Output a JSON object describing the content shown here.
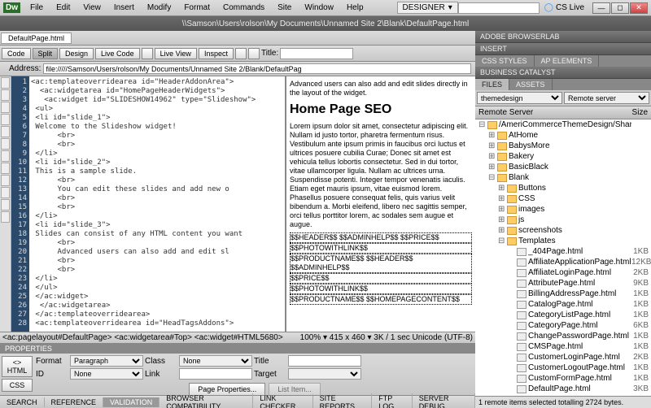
{
  "menu": {
    "items": [
      "File",
      "Edit",
      "View",
      "Insert",
      "Modify",
      "Format",
      "Commands",
      "Site",
      "Window",
      "Help"
    ],
    "layout": "DESIGNER",
    "cslive": "CS Live"
  },
  "appicon": "Dw",
  "pathbar": {
    "center": "\\\\Samson\\Users\\rolson\\My Documents\\Unnamed Site 2\\Blank\\DefaultPage.html"
  },
  "doctabs": [
    "DefaultPage.html"
  ],
  "viewmodes": {
    "code": "Code",
    "split": "Split",
    "design": "Design",
    "livecode": "Live Code",
    "liveview": "Live View",
    "inspect": "Inspect",
    "titlelabel": "Title:",
    "titlevalue": ""
  },
  "address": {
    "label": "Address:",
    "value": "file://///Samson/Users/rolson/My Documents/Unnamed Site 2/Blank/DefaultPag"
  },
  "code_lines": [
    "<ac:templateoverridearea id=\"HeaderAddonArea\">",
    "  <ac:widgetarea id=\"HomePageHeaderWidgets\">",
    "   <ac:widget id=\"SLIDESHOW14962\" type=\"Slideshow\">",
    " <ul>",
    " <li id=\"slide_1\">",
    " Welcome to the Slideshow widget!",
    "      <br>",
    "      <br>",
    " </li>",
    " <li id=\"slide_2\">",
    " This is a sample slide.",
    "      <br>",
    "      You can edit these slides and add new o",
    "      <br>",
    "      <br>",
    " </li>",
    " <li id=\"slide_3\">",
    " Slides can consist of any HTML content you want",
    "      <br>",
    "      Advanced users can also add and edit sl",
    "      <br>",
    "      <br>",
    " </li>",
    " </ul>",
    " </ac:widget>",
    "  </ac:widgetarea>",
    " </ac:templateoverridearea>",
    " <ac:templateoverridearea id=\"HeadTagsAddons\">"
  ],
  "preview": {
    "para1": "Advanced users can also add and edit slides directly in the layout of the widget.",
    "heading": "Home Page SEO",
    "para2": "Lorem ipsum dolor sit amet, consectetur adipiscing elit. Nullam id justo tortor, pharetra fermentum risus. Vestibulum ante ipsum primis in faucibus orci luctus et ultrices posuere cubilia Curae; Donec sit amet est vehicula tellus lobortis consectetur. Sed in dui tortor, vitae ullamcorper ligula. Nullam ac ultrices urna. Suspendisse potenti. Integer tempor venenatis iaculis. Etiam eget mauris ipsum, vitae euismod lorem. Phasellus posuere consequat felis, quis varius velit bibendum a. Morbi eleifend, libero nec sagittis semper, orci tellus porttitor lorem, ac sodales sem augue et augue.",
    "placeholders": [
      "$$HEADER$$ $$ADMINHELP$$ $$PRICE$$",
      "$$PHOTOWITHLINK$$",
      "$$PRODUCTNAME$$ $$HEADER$$ $$ADMINHELP$$",
      "$$PRICE$$",
      "$$PHOTOWITHLINK$$",
      "$$PRODUCTNAME$$ $$HOMEPAGECONTENT$$"
    ]
  },
  "breadcrumb": {
    "path": "<ac:pagelayout#DefaultPage> <ac:widgetarea#Top> <ac:widget#HTML5680>",
    "meta": "100% ▾ 415 x 460 ▾ 3K / 1 sec Unicode (UTF-8)"
  },
  "properties": {
    "title": "PROPERTIES",
    "tabs": [
      "<> HTML",
      "CSS"
    ],
    "format_label": "Format",
    "format_value": "Paragraph",
    "class_label": "Class",
    "class_value": "None",
    "id_label": "ID",
    "id_value": "None",
    "link_label": "Link",
    "link_value": "",
    "titlef_label": "Title",
    "titlef_value": "",
    "target_label": "Target",
    "target_value": "",
    "pageprops": "Page Properties...",
    "listitem": "List Item..."
  },
  "bottomtabs": [
    "SEARCH",
    "REFERENCE",
    "VALIDATION",
    "BROWSER COMPATIBILITY",
    "LINK CHECKER",
    "SITE REPORTS",
    "FTP LOG",
    "SERVER DEBUG"
  ],
  "bottomtabs_active": 2,
  "rightpanels": {
    "browserlab": "ADOBE BROWSERLAB",
    "insert": "INSERT",
    "css": "CSS STYLES",
    "ap": "AP ELEMENTS",
    "business": "BUSINESS CATALYST",
    "files": "FILES",
    "assets": "ASSETS",
    "site": "themedesign",
    "conn": "Remote server",
    "treehead": {
      "server": "Remote Server",
      "size": "Size"
    },
    "rootpath": "/AmeriCommerceThemeDesign/Shared/Themes/",
    "folders_closed": [
      "AtHome",
      "BabysMore",
      "Bakery",
      "BasicBlack"
    ],
    "blank": "Blank",
    "blank_folders": [
      "Buttons",
      "CSS",
      "images",
      "js",
      "screenshots"
    ],
    "templates": "Templates",
    "template_files": [
      {
        "n": "_404Page.html",
        "s": "1KB"
      },
      {
        "n": "AffiliateApplicationPage.html",
        "s": "12KB"
      },
      {
        "n": "AffiliateLoginPage.html",
        "s": "2KB"
      },
      {
        "n": "AttributePage.html",
        "s": "9KB"
      },
      {
        "n": "BillingAddressPage.html",
        "s": "1KB"
      },
      {
        "n": "CatalogPage.html",
        "s": "1KB"
      },
      {
        "n": "CategoryListPage.html",
        "s": "1KB"
      },
      {
        "n": "CategoryPage.html",
        "s": "6KB"
      },
      {
        "n": "ChangePasswordPage.html",
        "s": "1KB"
      },
      {
        "n": "CMSPage.html",
        "s": "1KB"
      },
      {
        "n": "CustomerLoginPage.html",
        "s": "2KB"
      },
      {
        "n": "CustomerLogoutPage.html",
        "s": "1KB"
      },
      {
        "n": "CustomFormPage.html",
        "s": "1KB"
      },
      {
        "n": "DefaultPage.html",
        "s": "3KB"
      }
    ],
    "statusbar": "1 remote items selected totalling 2724 bytes."
  }
}
